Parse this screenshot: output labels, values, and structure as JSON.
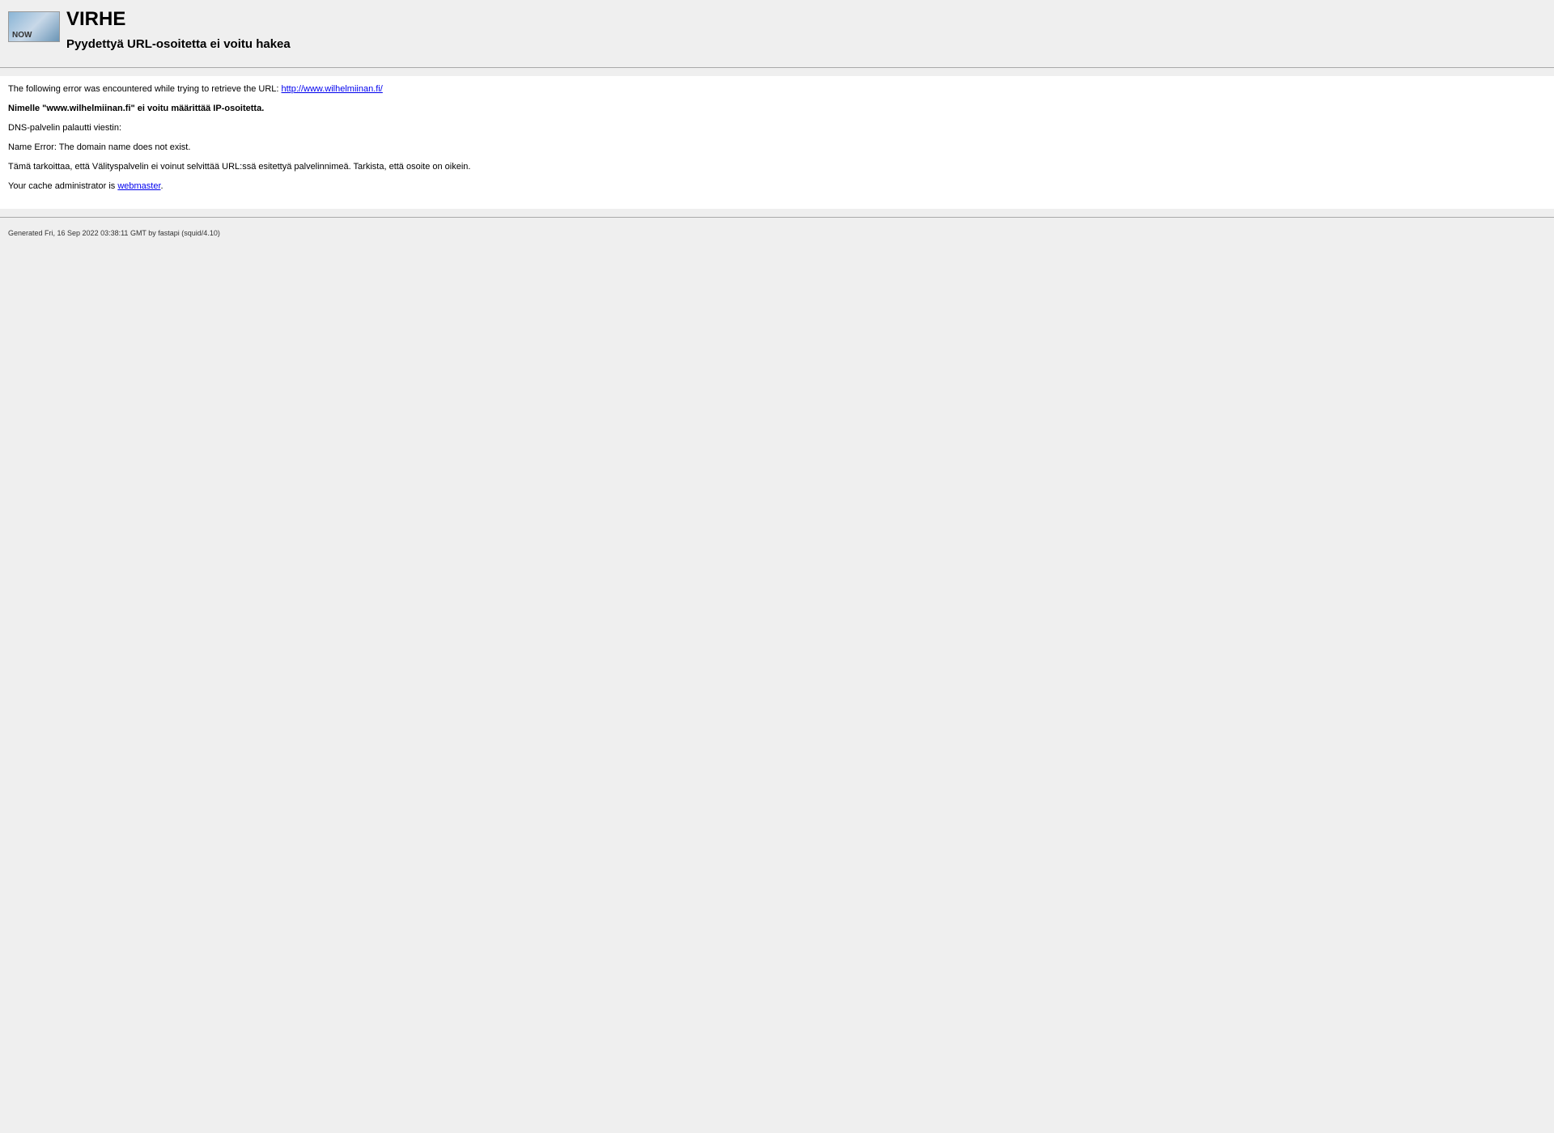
{
  "header": {
    "logo_text": "NOW",
    "title": "VIRHE",
    "subtitle": "Pyydettyä URL-osoitetta ei voitu hakea"
  },
  "content": {
    "intro_text": "The following error was encountered while trying to retrieve the URL: ",
    "url_link": "http://www.wilhelmiinan.fi/",
    "error_bold": "Nimelle \"www.wilhelmiinan.fi\" ei voitu määrittää IP-osoitetta.",
    "dns_message": "DNS-palvelin palautti viestin:",
    "name_error": "Name Error: The domain name does not exist.",
    "explanation": "Tämä tarkoittaa, että Välityspalvelin ei voinut selvittää URL:ssä esitettyä palvelinnimeä. Tarkista, että osoite on oikein.",
    "admin_text": "Your cache administrator is ",
    "admin_link": "webmaster",
    "admin_suffix": "."
  },
  "footer": {
    "generated_text": "Generated Fri, 16 Sep 2022 03:38:11 GMT by fastapi (squid/4.10)"
  }
}
